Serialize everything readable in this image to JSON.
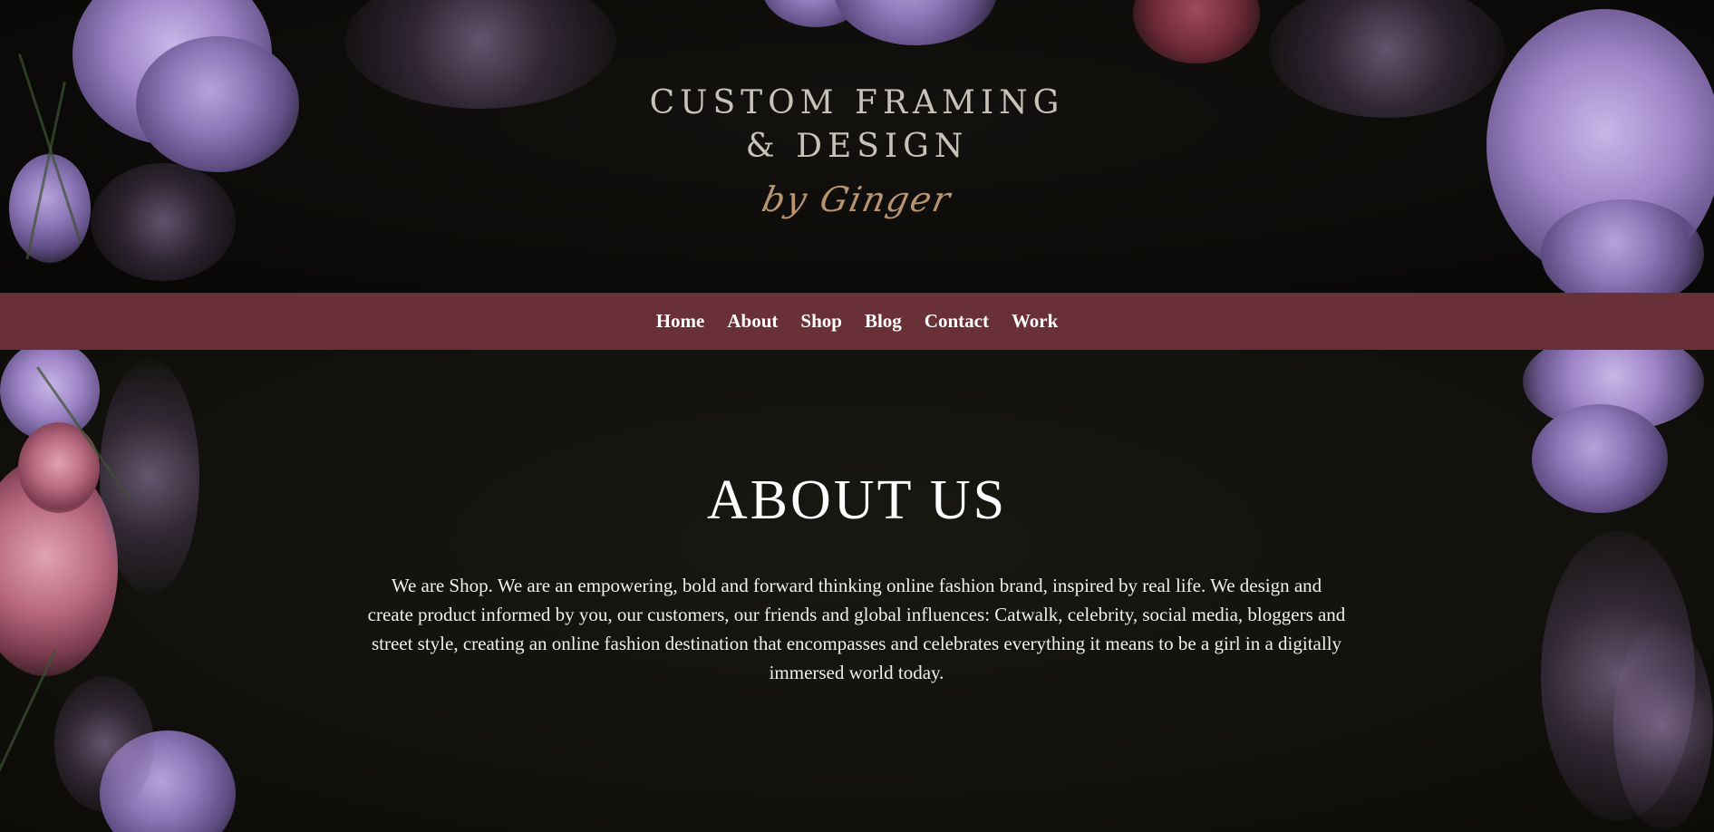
{
  "logo": {
    "line1": "CUSTOM FRAMING",
    "line2": "& DESIGN",
    "script": "by Ginger"
  },
  "nav": {
    "items": [
      {
        "label": "Home"
      },
      {
        "label": "About"
      },
      {
        "label": "Shop"
      },
      {
        "label": "Blog"
      },
      {
        "label": "Contact"
      },
      {
        "label": "Work"
      }
    ]
  },
  "about": {
    "title": "ABOUT US",
    "body": "We are Shop. We are an empowering, bold and forward thinking online fashion brand, inspired by real life. We design and create product informed by you, our customers, our friends and global influences: Catwalk, celebrity, social media, bloggers and street style, creating an online fashion destination that encompasses and celebrates everything it means to be a girl in a digitally immersed world today."
  },
  "colors": {
    "background": "#0f0e0b",
    "navbar": "#6a3038",
    "logo_text": "#c8c3b8",
    "logo_script": "#b99470",
    "text": "#ffffff"
  }
}
